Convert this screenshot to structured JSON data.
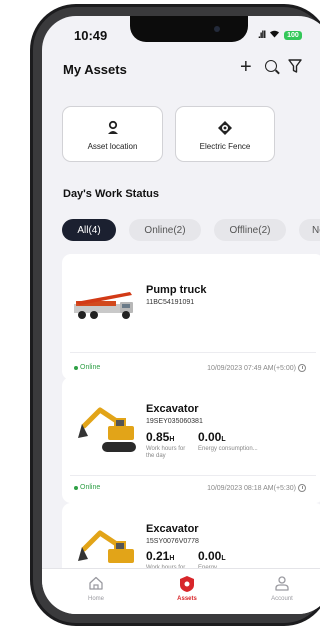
{
  "status_bar": {
    "time": "10:49",
    "signal": ".ıll",
    "battery": "100"
  },
  "header": {
    "title": "My Assets",
    "plus_icon": "plus-icon",
    "search_icon": "search-icon",
    "filter_icon": "filter-icon"
  },
  "shortcuts": [
    {
      "label": "Asset location",
      "icon": "person-pin-icon"
    },
    {
      "label": "Electric Fence",
      "icon": "fence-target-icon"
    }
  ],
  "work_status": {
    "title": "Day's Work Status",
    "tabs": [
      {
        "label": "All(4)",
        "active": true
      },
      {
        "label": "Online(2)",
        "active": false
      },
      {
        "label": "Offline(2)",
        "active": false
      },
      {
        "label": "Not",
        "active": false
      }
    ]
  },
  "assets": [
    {
      "name": "Pump truck",
      "id": "11BC54191091",
      "status": "Online",
      "timestamp": "10/09/2023 07:49 AM(+5:00)",
      "image": "pump-truck-icon"
    },
    {
      "name": "Excavator",
      "id": "19SEY035060381",
      "work_hours": {
        "value": "0.85",
        "unit": "H",
        "label": "Work hours for the day"
      },
      "energy": {
        "value": "0.00",
        "unit": "L",
        "label": "Energy consumption..."
      },
      "status": "Online",
      "timestamp": "10/09/2023 08:18 AM(+5:30)",
      "image": "excavator-icon"
    },
    {
      "name": "Excavator",
      "id": "15SY0076V0778",
      "work_hours": {
        "value": "0.21",
        "unit": "H",
        "label": "Work hours for"
      },
      "energy": {
        "value": "0.00",
        "unit": "L",
        "label": "Energy"
      },
      "image": "excavator-icon"
    }
  ],
  "tab_bar": [
    {
      "label": "Home",
      "icon": "home-icon",
      "active": false
    },
    {
      "label": "Assets",
      "icon": "assets-shield-icon",
      "active": true
    },
    {
      "label": "Account",
      "icon": "account-icon",
      "active": false
    }
  ],
  "colors": {
    "accent": "#d8262a",
    "active_tab": "#1b2030",
    "online": "#2fa046",
    "battery": "#34c759"
  }
}
